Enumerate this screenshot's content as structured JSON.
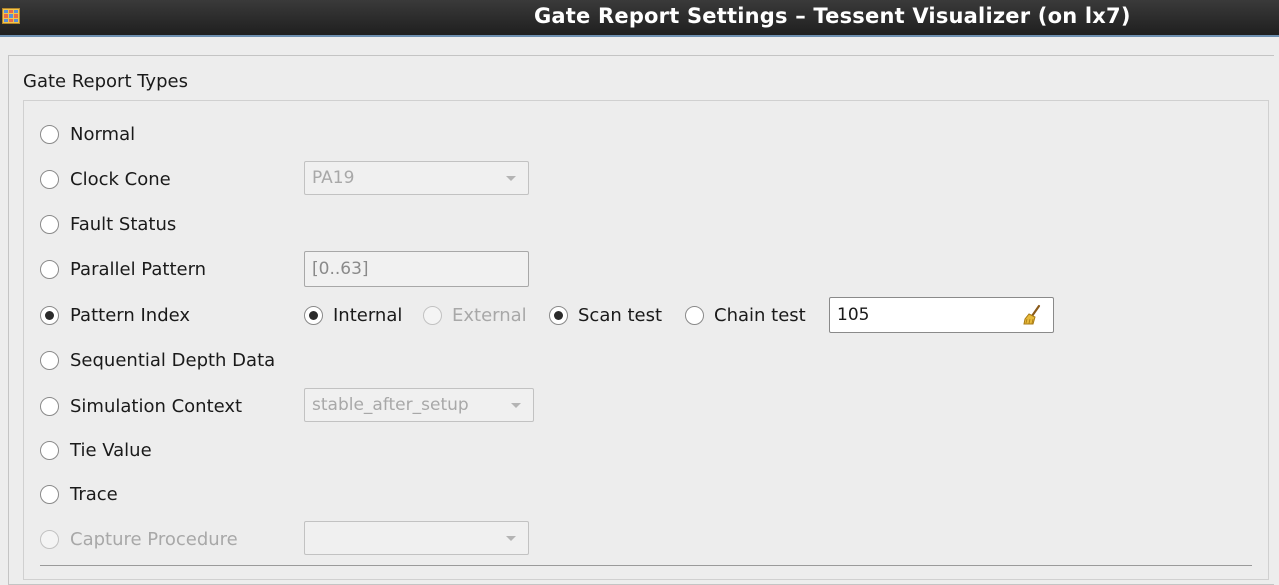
{
  "window": {
    "title": "Gate Report Settings – Tessent Visualizer (on lx7)",
    "icon": "spreadsheet-app-icon"
  },
  "group": {
    "title": "Gate Report Types"
  },
  "options": {
    "normal": {
      "label": "Normal",
      "selected": false,
      "enabled": true
    },
    "clock_cone": {
      "label": "Clock Cone",
      "selected": false,
      "enabled": true,
      "combo_value": "PA19"
    },
    "fault_status": {
      "label": "Fault Status",
      "selected": false,
      "enabled": true
    },
    "parallel_pattern": {
      "label": "Parallel Pattern",
      "selected": false,
      "enabled": true,
      "field_value": "[0..63]"
    },
    "pattern_index": {
      "label": "Pattern Index",
      "selected": true,
      "enabled": true,
      "internal_label": "Internal",
      "internal_selected": true,
      "external_label": "External",
      "external_selected": false,
      "external_enabled": false,
      "scan_test_label": "Scan test",
      "scan_test_selected": true,
      "chain_test_label": "Chain test",
      "chain_test_selected": false,
      "index_value": "105",
      "clear_icon": "broom-icon"
    },
    "sequential_depth": {
      "label": "Sequential Depth Data",
      "selected": false,
      "enabled": true
    },
    "simulation_context": {
      "label": "Simulation Context",
      "selected": false,
      "enabled": true,
      "combo_value": "stable_after_setup"
    },
    "tie_value": {
      "label": "Tie Value",
      "selected": false,
      "enabled": true
    },
    "trace": {
      "label": "Trace",
      "selected": false,
      "enabled": true
    },
    "capture_procedure": {
      "label": "Capture Procedure",
      "selected": false,
      "enabled": false,
      "combo_value": ""
    }
  },
  "colors": {
    "titlebar": "#2b2b2b",
    "titlebar_accent": "#6d8fb0",
    "background": "#ededed",
    "disabled_text": "#a8a8a8"
  }
}
